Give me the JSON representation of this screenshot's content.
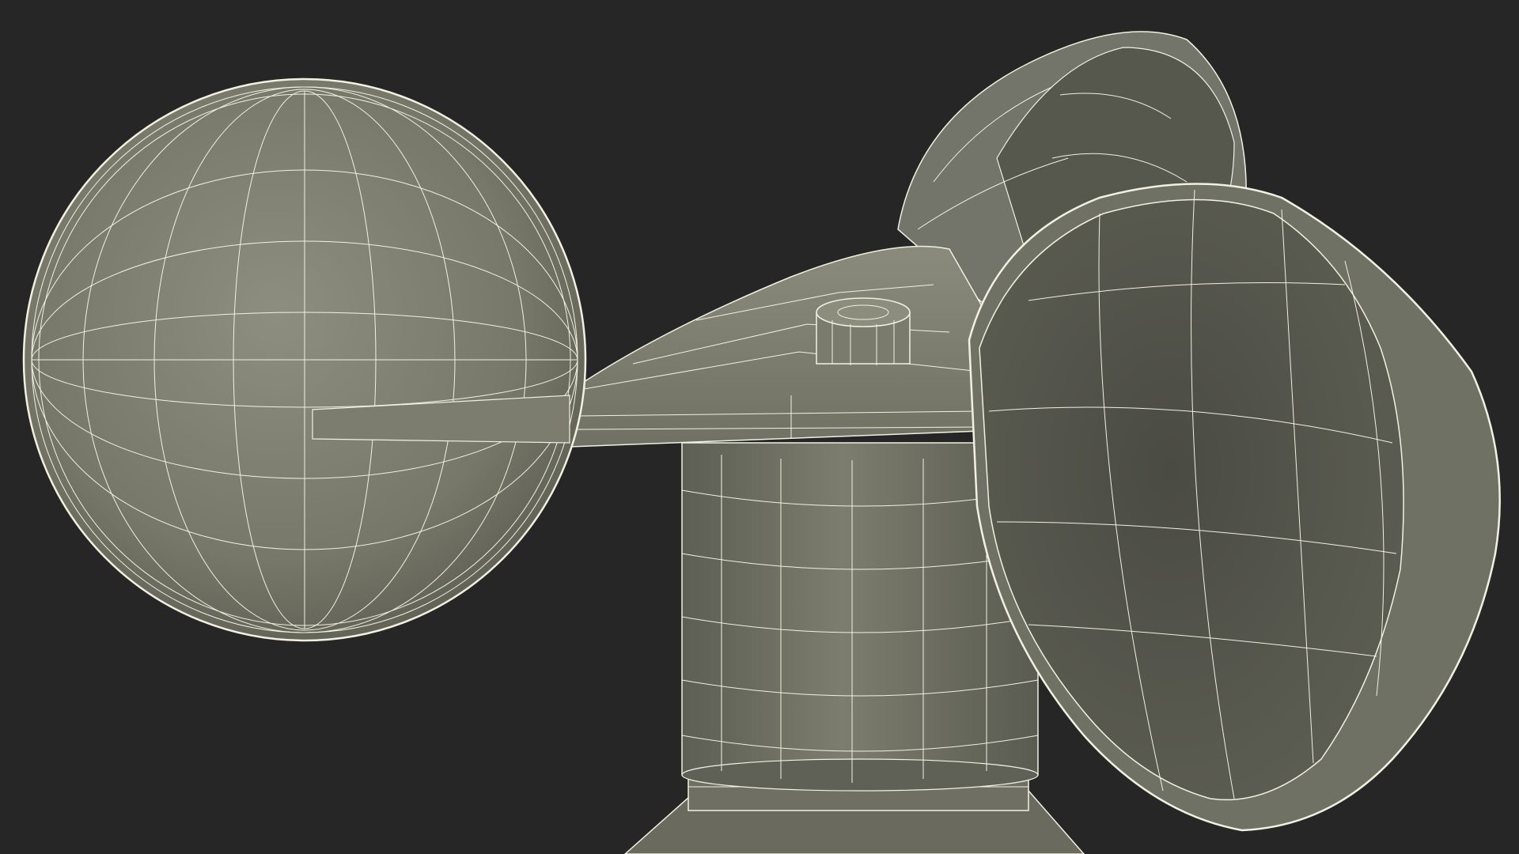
{
  "scene": {
    "background_color": "#262626",
    "surface_color": "#777869",
    "surface_dark_color": "#4e4f46",
    "wire_color": "#f2f1e1",
    "object": "anemometer-wireframe",
    "parts": [
      "cup-left",
      "cup-back-right",
      "cup-front-right",
      "arm-hub",
      "center-cap",
      "body-cylinder",
      "base-ring"
    ]
  }
}
